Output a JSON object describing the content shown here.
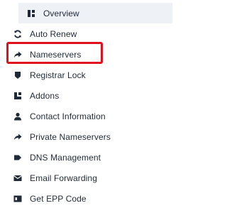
{
  "menu": {
    "items": [
      {
        "label": "Overview",
        "icon": "overview-icon",
        "active": true
      },
      {
        "label": "Auto Renew",
        "icon": "sync-icon"
      },
      {
        "label": "Nameservers",
        "icon": "share-arrow-icon",
        "highlighted": true
      },
      {
        "label": "Registrar Lock",
        "icon": "shield-icon"
      },
      {
        "label": "Addons",
        "icon": "addons-icon"
      },
      {
        "label": "Contact Information",
        "icon": "user-icon"
      },
      {
        "label": "Private Nameservers",
        "icon": "share-arrow-icon"
      },
      {
        "label": "DNS Management",
        "icon": "tag-icon"
      },
      {
        "label": "Email Forwarding",
        "icon": "envelope-icon"
      },
      {
        "label": "Get EPP Code",
        "icon": "code-icon"
      }
    ]
  },
  "colors": {
    "text": "#1f2937",
    "active_background": "#eef1f6",
    "highlight_border": "#e0101f"
  }
}
